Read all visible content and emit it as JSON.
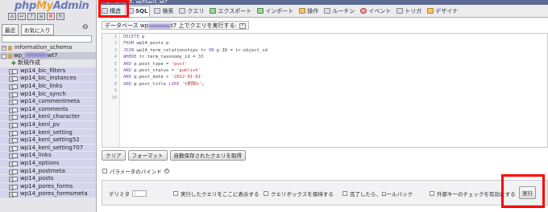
{
  "app": {
    "logo_part1": "php",
    "logo_part2": "My",
    "logo_part3": "Admin"
  },
  "nav": {
    "tab_recent": "最近",
    "tab_favorites": "お気に入り",
    "filter_placeholder": "",
    "info_schema": "information_schema",
    "db_name": "wp_",
    "db_suffix": "wt7",
    "new_item": "新規作成",
    "tables": [
      "wp14_bic_filters",
      "wp14_bic_instances",
      "wp14_bic_links",
      "wp14_bic_synch",
      "wp14_commentmeta",
      "wp14_comments",
      "wp14_kenl_character",
      "wp14_kenl_pv",
      "wp14_kenl_setting",
      "wp14_kenl_setting52",
      "wp14_kenl_setting707",
      "wp14_links",
      "wp14_options",
      "wp14_postmeta",
      "wp14_posts",
      "wp14_pores_forms",
      "wp14_pores_formsmeta"
    ]
  },
  "tabs": [
    {
      "label": "構造"
    },
    {
      "label": "SQL"
    },
    {
      "label": "検索"
    },
    {
      "label": "クエリ"
    },
    {
      "label": "エクスポート"
    },
    {
      "label": "インポート"
    },
    {
      "label": "操作"
    },
    {
      "label": "ルーチン"
    },
    {
      "label": "イベント"
    },
    {
      "label": "トリガ"
    },
    {
      "label": "デザイナ"
    }
  ],
  "breadcrumb": "データベース: wp55aci1_wt7",
  "query_title": {
    "prefix": "データベース wp",
    "suffix": "t7 上でクエリを実行する:"
  },
  "editor": {
    "line_numbers": [
      "1",
      "2",
      "3",
      "4",
      "5",
      "6",
      "7",
      "8",
      "9",
      "10"
    ],
    "lines": [
      "DELETE p",
      "FROM wp14_posts p",
      "JOIN wp14_term_relationships tr ON p.ID = tr.object_id",
      "WHERE tr.term_taxonomy_id = 33",
      "AND p.post_type = 'post'",
      "AND p.post_status = 'publish'",
      "AND p.post_date > '2022-01-01'",
      "AND p.post_title LIKE '%削除%';",
      "",
      ""
    ]
  },
  "buttons": {
    "clear": "クリア",
    "format": "フォーマット",
    "restore": "自動保存されたクエリを取得"
  },
  "bind_params": "パラメータのバインド",
  "options": {
    "delimiter_label": "デリミタ",
    "delimiter_value": ";",
    "show_query": "実行したクエリをここに表示する",
    "retain_query": "クエリボックスを保持する",
    "rollback": "完了したら、ロールバック",
    "fk_check": "外部キーのチェックを有効にする",
    "go": "実行"
  }
}
